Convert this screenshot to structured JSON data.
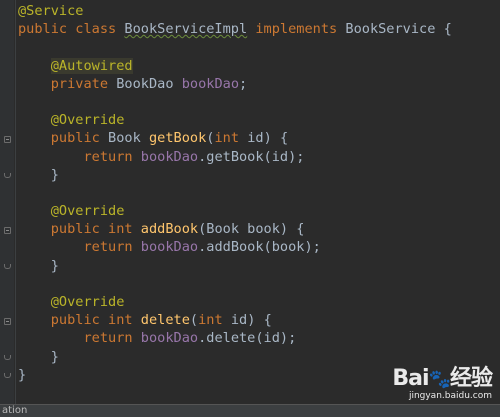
{
  "editor": {
    "lines": [
      [
        {
          "t": "@Service",
          "c": "ann"
        }
      ],
      [
        {
          "t": "public class ",
          "c": "kw"
        },
        {
          "t": "BookServiceImpl",
          "c": "cls-underline"
        },
        {
          "t": " implements ",
          "c": "kw"
        },
        {
          "t": "BookService {",
          "c": ""
        }
      ],
      [],
      [
        {
          "t": "    ",
          "c": ""
        },
        {
          "t": "@Autowired",
          "c": "ann-hl"
        }
      ],
      [
        {
          "t": "    ",
          "c": ""
        },
        {
          "t": "private ",
          "c": "kw"
        },
        {
          "t": "BookDao ",
          "c": ""
        },
        {
          "t": "bookDao",
          "c": "fld"
        },
        {
          "t": ";",
          "c": ""
        }
      ],
      [],
      [
        {
          "t": "    ",
          "c": ""
        },
        {
          "t": "@Override",
          "c": "ann"
        }
      ],
      [
        {
          "t": "    ",
          "c": ""
        },
        {
          "t": "public ",
          "c": "kw"
        },
        {
          "t": "Book ",
          "c": ""
        },
        {
          "t": "getBook",
          "c": "mth"
        },
        {
          "t": "(",
          "c": ""
        },
        {
          "t": "int ",
          "c": "kw"
        },
        {
          "t": "id) {",
          "c": ""
        }
      ],
      [
        {
          "t": "        ",
          "c": ""
        },
        {
          "t": "return ",
          "c": "kw"
        },
        {
          "t": "bookDao",
          "c": "fld"
        },
        {
          "t": ".getBook(id);",
          "c": ""
        }
      ],
      [
        {
          "t": "    }",
          "c": ""
        }
      ],
      [],
      [
        {
          "t": "    ",
          "c": ""
        },
        {
          "t": "@Override",
          "c": "ann"
        }
      ],
      [
        {
          "t": "    ",
          "c": ""
        },
        {
          "t": "public int ",
          "c": "kw"
        },
        {
          "t": "addBook",
          "c": "mth"
        },
        {
          "t": "(Book book) {",
          "c": ""
        }
      ],
      [
        {
          "t": "        ",
          "c": ""
        },
        {
          "t": "return ",
          "c": "kw"
        },
        {
          "t": "bookDao",
          "c": "fld"
        },
        {
          "t": ".addBook(book);",
          "c": ""
        }
      ],
      [
        {
          "t": "    }",
          "c": ""
        }
      ],
      [],
      [
        {
          "t": "    ",
          "c": ""
        },
        {
          "t": "@Override",
          "c": "ann"
        }
      ],
      [
        {
          "t": "    ",
          "c": ""
        },
        {
          "t": "public int ",
          "c": "kw"
        },
        {
          "t": "delete",
          "c": "mth"
        },
        {
          "t": "(",
          "c": ""
        },
        {
          "t": "int ",
          "c": "kw"
        },
        {
          "t": "id) {",
          "c": ""
        }
      ],
      [
        {
          "t": "        ",
          "c": ""
        },
        {
          "t": "return ",
          "c": "kw"
        },
        {
          "t": "bookDao",
          "c": "fld"
        },
        {
          "t": ".delete(id);",
          "c": ""
        }
      ],
      [
        {
          "t": "    }",
          "c": ""
        }
      ],
      [
        {
          "t": "}",
          "c": ""
        }
      ]
    ]
  },
  "status_bar": {
    "text": "ation"
  },
  "watermark": {
    "logo": "Bai",
    "logo_suffix": "经验",
    "url": "jingyan.baidu.com"
  },
  "colors": {
    "background": "#2b2b2b",
    "keyword": "#cc7832",
    "annotation": "#bbb529",
    "field": "#9876aa",
    "method": "#ffc66d",
    "text": "#a9b7c6"
  }
}
